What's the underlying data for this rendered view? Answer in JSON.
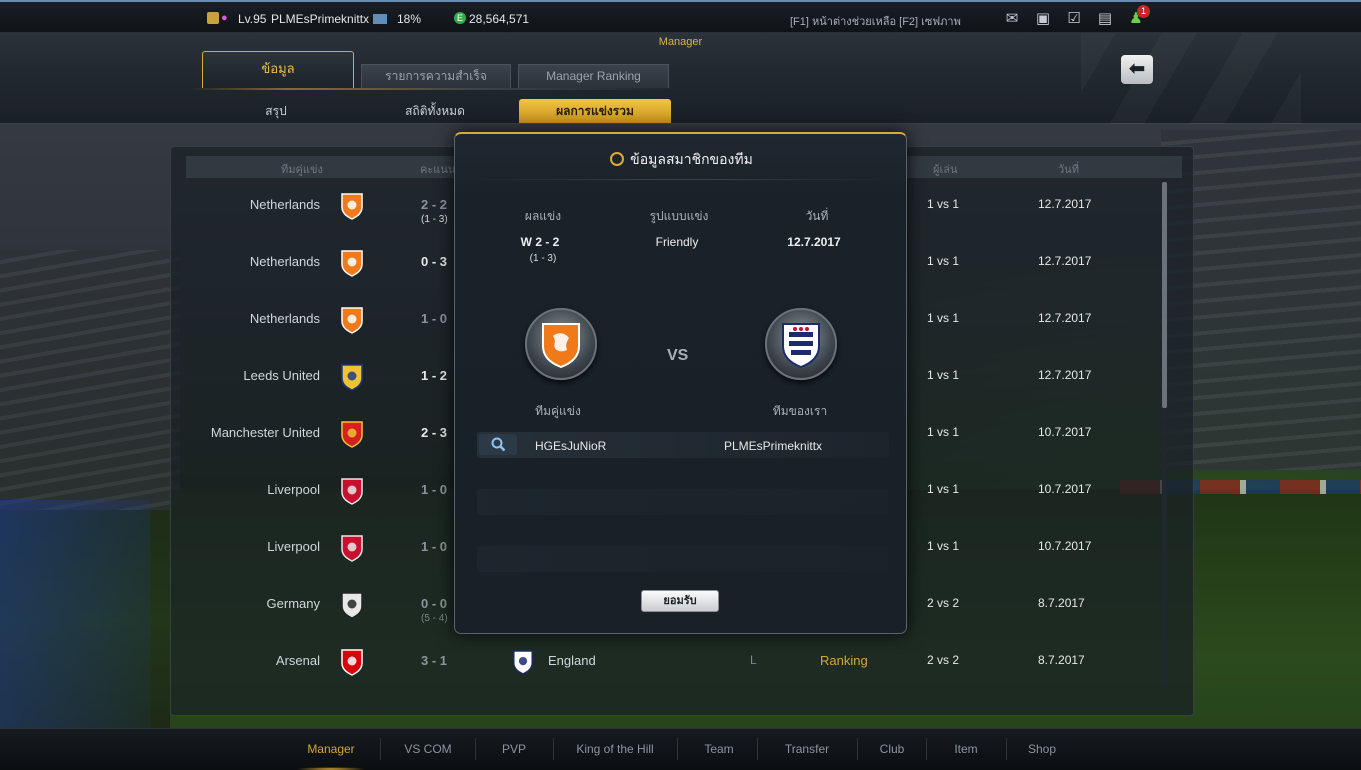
{
  "topbar": {
    "level": "Lv.95",
    "player_name": "PLMEsPrimeknittx",
    "exp_percent": "18%",
    "money": "28,564,571",
    "help_text": "[F1] หน้าต่างช่วยเหลือ [F2] เซฟภาพ",
    "notification_count": "1",
    "icons": [
      "mail-icon",
      "profile-card-icon",
      "calendar-check-icon",
      "chat-icon",
      "friend-icon"
    ]
  },
  "header": {
    "title": "Manager",
    "tabs": [
      {
        "label": "ข้อมูล",
        "active": true
      },
      {
        "label": "รายการความสำเร็จ",
        "active": false
      },
      {
        "label": "Manager Ranking",
        "active": false
      }
    ],
    "subtabs": [
      {
        "label": "สรุป",
        "active": false
      },
      {
        "label": "สถิติทั้งหมด",
        "active": false
      },
      {
        "label": "ผลการแข่งรวม",
        "active": true
      }
    ]
  },
  "table": {
    "columns": [
      "ทีมคู่แข่ง",
      "คะแนน",
      "ผู้เล่น",
      "วันที่"
    ],
    "rows": [
      {
        "team": "Netherlands",
        "badge": "netherlands-crest-icon",
        "score": "2 - 2",
        "pk": "(1 - 3)",
        "highlight": false,
        "mode": "1 vs 1",
        "date": "12.7.2017"
      },
      {
        "team": "Netherlands",
        "badge": "netherlands-crest-icon",
        "score": "0 - 3",
        "pk": "",
        "highlight": true,
        "mode": "1 vs 1",
        "date": "12.7.2017"
      },
      {
        "team": "Netherlands",
        "badge": "netherlands-crest-icon",
        "score": "1 - 0",
        "pk": "",
        "highlight": false,
        "mode": "1 vs 1",
        "date": "12.7.2017"
      },
      {
        "team": "Leeds United",
        "badge": "leeds-united-crest-icon",
        "score": "1 - 2",
        "pk": "",
        "highlight": true,
        "mode": "1 vs 1",
        "date": "12.7.2017"
      },
      {
        "team": "Manchester United",
        "badge": "manchester-united-crest-icon",
        "score": "2 - 3",
        "pk": "",
        "highlight": true,
        "mode": "1 vs 1",
        "date": "10.7.2017"
      },
      {
        "team": "Liverpool",
        "badge": "liverpool-crest-icon",
        "score": "1 - 0",
        "pk": "",
        "highlight": false,
        "mode": "1 vs 1",
        "date": "10.7.2017"
      },
      {
        "team": "Liverpool",
        "badge": "liverpool-crest-icon",
        "score": "1 - 0",
        "pk": "",
        "highlight": false,
        "mode": "1 vs 1",
        "date": "10.7.2017"
      },
      {
        "team": "Germany",
        "badge": "germany-crest-icon",
        "score": "0 - 0",
        "pk": "(5 - 4)",
        "highlight": false,
        "mode": "2 vs 2",
        "date": "8.7.2017"
      },
      {
        "team": "Arsenal",
        "badge": "arsenal-crest-icon",
        "score": "3 - 1",
        "pk": "",
        "highlight": false,
        "mode": "2 vs 2",
        "date": "8.7.2017",
        "own_team": "England",
        "result": "L",
        "kind": "Ranking"
      }
    ]
  },
  "modal": {
    "title": "ข้อมูลสมาชิกของทีม",
    "labels": {
      "result": "ผลแข่ง",
      "format": "รูปแบบแข่ง",
      "date": "วันที่"
    },
    "result": "W  2 - 2",
    "pk": "(1 - 3)",
    "format": "Friendly",
    "date": "12.7.2017",
    "vs": "VS",
    "opponent_label": "ทีมคู่แข่ง",
    "our_label": "ทีมของเรา",
    "opponent_crest": "netherlands-crest-icon",
    "our_crest": "england-crest-icon",
    "opponent_player": "HGEsJuNioR",
    "our_player": "PLMEsPrimeknittx",
    "ok": "ยอมรับ"
  },
  "bottomnav": {
    "items": [
      "Manager",
      "VS COM",
      "PVP",
      "King of the Hill",
      "Team",
      "Transfer",
      "Club",
      "Item",
      "Shop"
    ],
    "active": "Manager"
  },
  "colors": {
    "accent": "#d9a83a",
    "active_tab": "#f2c445"
  }
}
